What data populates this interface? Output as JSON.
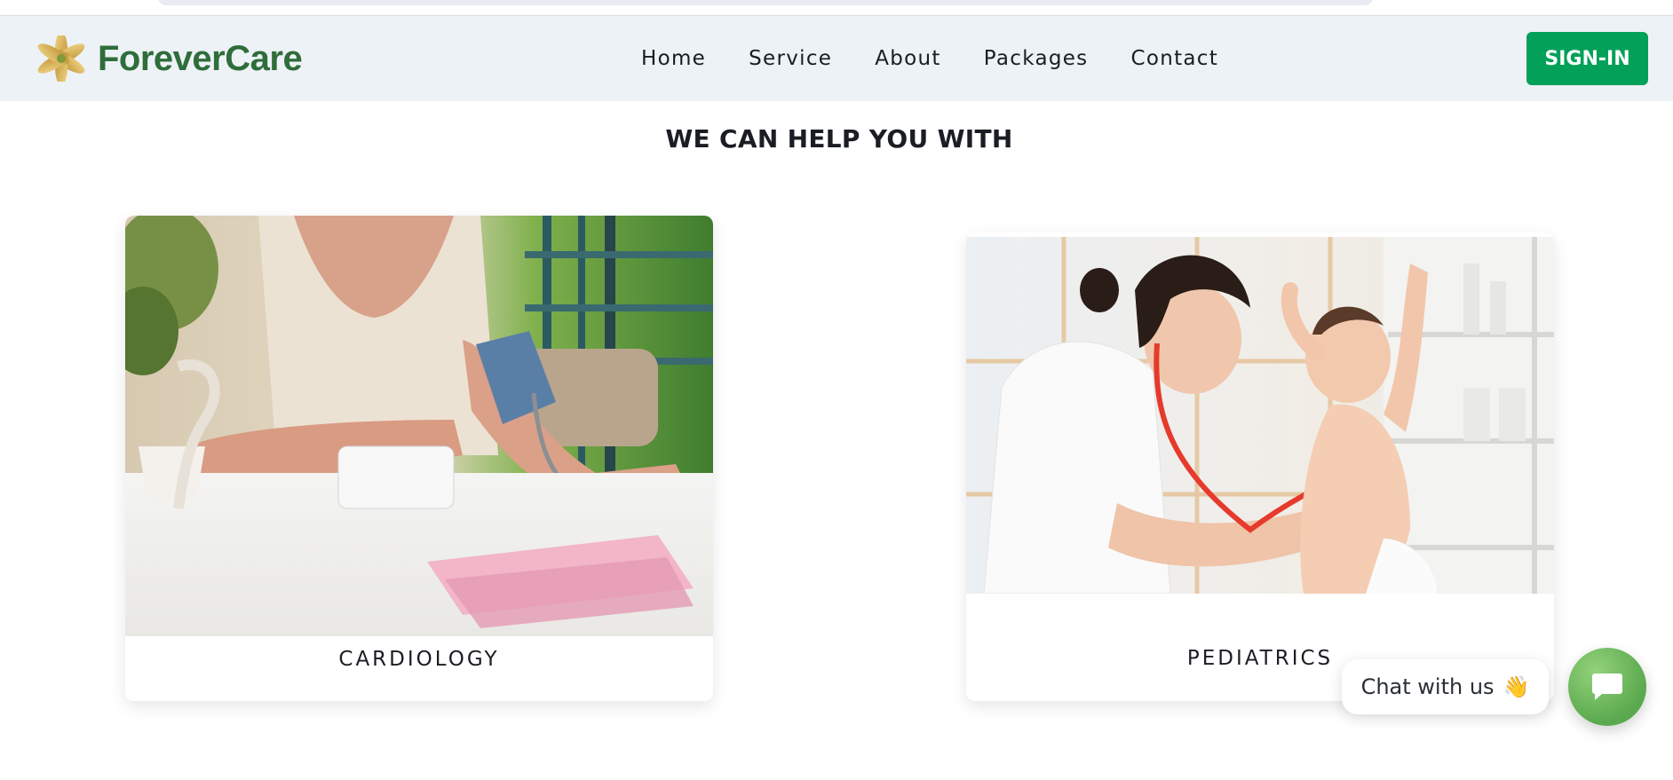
{
  "brand": {
    "name": "ForeverCare",
    "logo_icon": "flower-logo-icon"
  },
  "nav": {
    "items": [
      "Home",
      "Service",
      "About",
      "Packages",
      "Contact"
    ],
    "sign_in": "SIGN-IN",
    "sign_in_color": "#03a05a"
  },
  "section": {
    "title": "WE CAN HELP YOU WITH"
  },
  "cards": [
    {
      "label": "CARDIOLOGY",
      "image": "woman measuring blood pressure with a cuff at a table"
    },
    {
      "label": "PEDIATRICS",
      "image": "doctor examining a smiling baby with a stethoscope"
    }
  ],
  "chat": {
    "label": "Chat with us",
    "emoji": "👋",
    "icon": "chat-bubble-icon",
    "fab_color": "#6dbb5a"
  },
  "colors": {
    "header_bg": "#edf2f7",
    "brand_green": "#2f6d3a",
    "title": "#1a1d23"
  }
}
